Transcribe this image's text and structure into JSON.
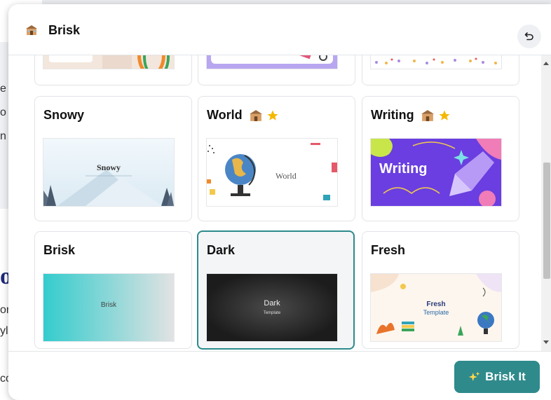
{
  "app": {
    "title": "Brisk"
  },
  "header": {
    "logo_icon": "schoolhouse-icon",
    "back_icon": "undo-icon"
  },
  "background_page": {
    "text_fragments": [
      "e",
      "o",
      "n",
      "o",
      "or",
      "yl",
      "co"
    ]
  },
  "templates": [
    {
      "name": "Snowy",
      "thumb_text": "Snowy",
      "badges": []
    },
    {
      "name": "World",
      "thumb_text": "World",
      "badges": [
        "schoolhouse-icon",
        "star-icon"
      ]
    },
    {
      "name": "Writing",
      "thumb_text": "Writing",
      "badges": [
        "schoolhouse-icon",
        "star-icon"
      ]
    },
    {
      "name": "Brisk",
      "thumb_text": "Brisk",
      "badges": []
    },
    {
      "name": "Dark",
      "thumb_text": "Dark",
      "thumb_subtext": "Template",
      "badges": [],
      "selected": true
    },
    {
      "name": "Fresh",
      "thumb_text": "Fresh",
      "thumb_subtext": "Template",
      "badges": []
    }
  ],
  "footer": {
    "action_label": "Brisk It",
    "action_icon": "sparkles-icon"
  },
  "colors": {
    "accent": "#2f8a8c",
    "selected_border": "#2c8a8c",
    "star": "#f5b800"
  }
}
